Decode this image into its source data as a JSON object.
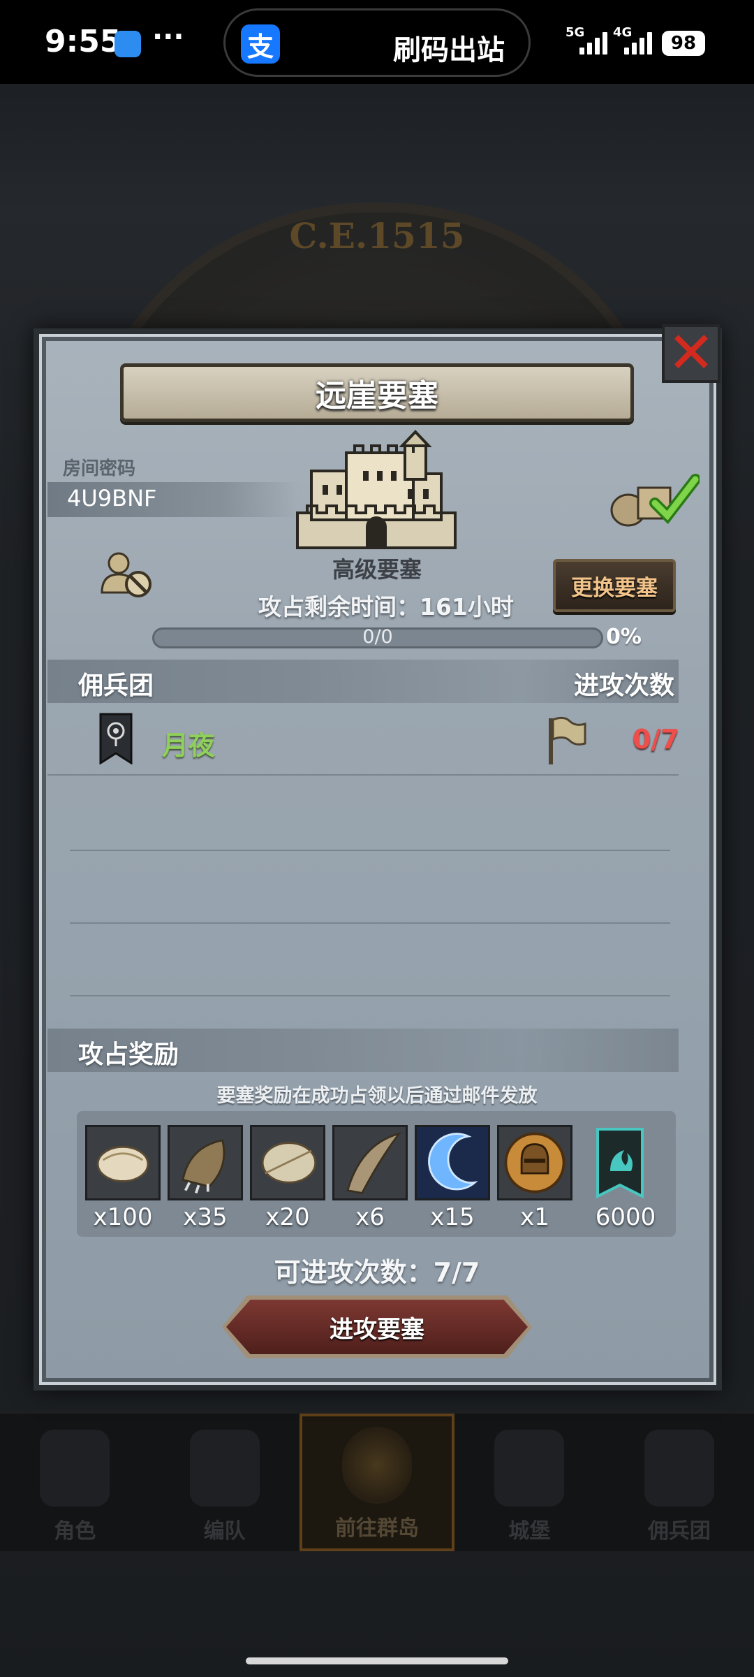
{
  "status_bar": {
    "time": "9:55",
    "dots": "···",
    "pill_icon": "支",
    "pill_text": "刷码出站",
    "net1": "5G",
    "net2": "4G",
    "battery": "98"
  },
  "background": {
    "era": "C.E.1515"
  },
  "modal": {
    "title": "远崖要塞",
    "room_label": "房间密码",
    "room_code": "4U9BNF",
    "fortress_tier": "高级要塞",
    "change_button": "更换要塞",
    "timer": "攻占剩余时间：161小时",
    "progress": {
      "count": "0/0",
      "percent": "0%",
      "fraction": 0
    },
    "guild_header": "佣兵团",
    "attack_header": "进攻次数",
    "guild": {
      "name": "月夜",
      "attacks": "0/7"
    },
    "rewards_header": "攻占奖励",
    "rewards_note": "要塞奖励在成功占领以后通过邮件发放",
    "rewards": [
      {
        "icon": "fur-pelt-icon",
        "qty": "x100"
      },
      {
        "icon": "beast-claw-icon",
        "qty": "x35"
      },
      {
        "icon": "feather-hide-icon",
        "qty": "x20"
      },
      {
        "icon": "horn-icon",
        "qty": "x6"
      },
      {
        "icon": "lightning-crescent-icon",
        "qty": "x15"
      },
      {
        "icon": "knight-helmet-coin-icon",
        "qty": "x1"
      },
      {
        "icon": "guild-banner-token-icon",
        "qty": "6000"
      }
    ],
    "attacks_left": "可进攻次数：7/7",
    "attack_button": "进攻要塞"
  },
  "bottom_nav": [
    {
      "label": "角色",
      "active": false
    },
    {
      "label": "编队",
      "active": false
    },
    {
      "label": "前往群岛",
      "active": true
    },
    {
      "label": "城堡",
      "active": false
    },
    {
      "label": "佣兵团",
      "active": false
    }
  ],
  "colors": {
    "guild_name": "#8ed05a",
    "attack_count": "#ef4e4a",
    "close_x": "#d32a1f",
    "change_button_text": "#f3c48a"
  }
}
